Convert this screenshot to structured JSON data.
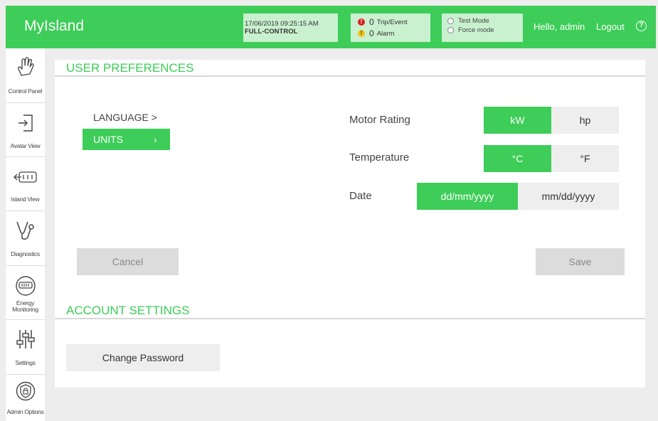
{
  "header": {
    "app_title": "MyIsland",
    "datetime": "17/06/2019 09:25:15 AM",
    "control_mode": "FULL-CONTROL",
    "alerts": [
      {
        "count": "0",
        "label": "Trip/Event",
        "icon": "error-icon",
        "color": "#e02020"
      },
      {
        "count": "0",
        "label": "Alarm",
        "icon": "warning-icon",
        "color": "#f0c419"
      }
    ],
    "modes": [
      "Test Mode",
      "Force mode"
    ],
    "greeting": "Hello, admin",
    "logout": "Logout",
    "help_icon": "help-icon"
  },
  "sidebar": {
    "items": [
      {
        "label": "Control Panel",
        "icon": "hand-pointer-icon"
      },
      {
        "label": "Avatar View",
        "icon": "enter-door-icon"
      },
      {
        "label": "Island View",
        "icon": "island-bus-icon"
      },
      {
        "label": "Diagnostics",
        "icon": "stethoscope-icon"
      },
      {
        "label": "Energy Monitoring",
        "icon": "energy-meter-icon"
      },
      {
        "label": "Settings",
        "icon": "sliders-icon"
      },
      {
        "label": "Admin Options",
        "icon": "admin-shield-icon"
      }
    ]
  },
  "user_prefs": {
    "title": "USER PREFERENCES",
    "menu": {
      "language": "LANGUAGE >",
      "units": "UNITS",
      "chevron": "›"
    },
    "motor": {
      "label": "Motor Rating",
      "options": [
        "kW",
        "hp"
      ],
      "selected": "kW"
    },
    "temperature": {
      "label": "Temperature",
      "options": [
        "°C",
        "°F"
      ],
      "selected": "°C"
    },
    "date": {
      "label": "Date",
      "options": [
        "dd/mm/yyyy",
        "mm/dd/yyyy"
      ],
      "selected": "dd/mm/yyyy"
    },
    "cancel": "Cancel",
    "save": "Save"
  },
  "account": {
    "title": "ACCOUNT SETTINGS",
    "change_password": "Change Password"
  },
  "colors": {
    "accent": "#3dcd58",
    "accent_light": "#c9f1cf",
    "error": "#e02020",
    "warning": "#f0c419"
  }
}
